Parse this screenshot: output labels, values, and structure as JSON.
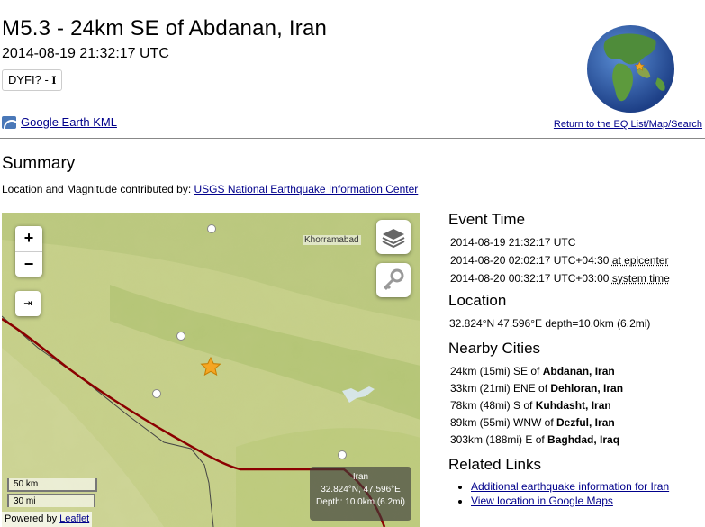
{
  "event": {
    "title": "M5.3 - 24km SE of Abdanan, Iran",
    "datetime": "2014-08-19 21:32:17 UTC",
    "dyfi_label": "DYFI? - ",
    "dyfi_value": "I"
  },
  "links": {
    "kml": "Google Earth KML",
    "return": "Return to the EQ List/Map/Search"
  },
  "summary": {
    "heading": "Summary",
    "contributed_prefix": "Location and Magnitude contributed by: ",
    "contributed_link": "USGS National Earthquake Information Center"
  },
  "map": {
    "zoom_in": "+",
    "zoom_out": "−",
    "fit_label": "⇥",
    "city_label": "Khorramabad",
    "scale_km": "50 km",
    "scale_mi": "30 mi",
    "attribution_prefix": "Powered by ",
    "attribution_link": "Leaflet",
    "info_region": "Iran",
    "info_coords": "32.824°N, 47.596°E",
    "info_depth": "Depth: 10.0km (6.2mi)",
    "colors": {
      "terrain": "#c3cf86",
      "border": "#8b0000",
      "epicenter": "#f5a623"
    }
  },
  "event_time": {
    "heading": "Event Time",
    "utc": "2014-08-19 21:32:17 UTC",
    "local": "2014-08-20 02:02:17 UTC+04:30",
    "local_suffix": "at epicenter",
    "system": "2014-08-20 00:32:17 UTC+03:00",
    "system_suffix": "system time"
  },
  "location": {
    "heading": "Location",
    "text": "32.824°N 47.596°E depth=10.0km (6.2mi)"
  },
  "nearby": {
    "heading": "Nearby Cities",
    "cities": [
      {
        "dist": "24km (15mi) SE of ",
        "name": "Abdanan, Iran"
      },
      {
        "dist": "33km (21mi) ENE of ",
        "name": "Dehloran, Iran"
      },
      {
        "dist": "78km (48mi) S of ",
        "name": "Kuhdasht, Iran"
      },
      {
        "dist": "89km (55mi) WNW of ",
        "name": "Dezful, Iran"
      },
      {
        "dist": "303km (188mi) E of ",
        "name": "Baghdad, Iraq"
      }
    ]
  },
  "related": {
    "heading": "Related Links",
    "items": [
      "Additional earthquake information for Iran",
      "View location in Google Maps"
    ]
  }
}
